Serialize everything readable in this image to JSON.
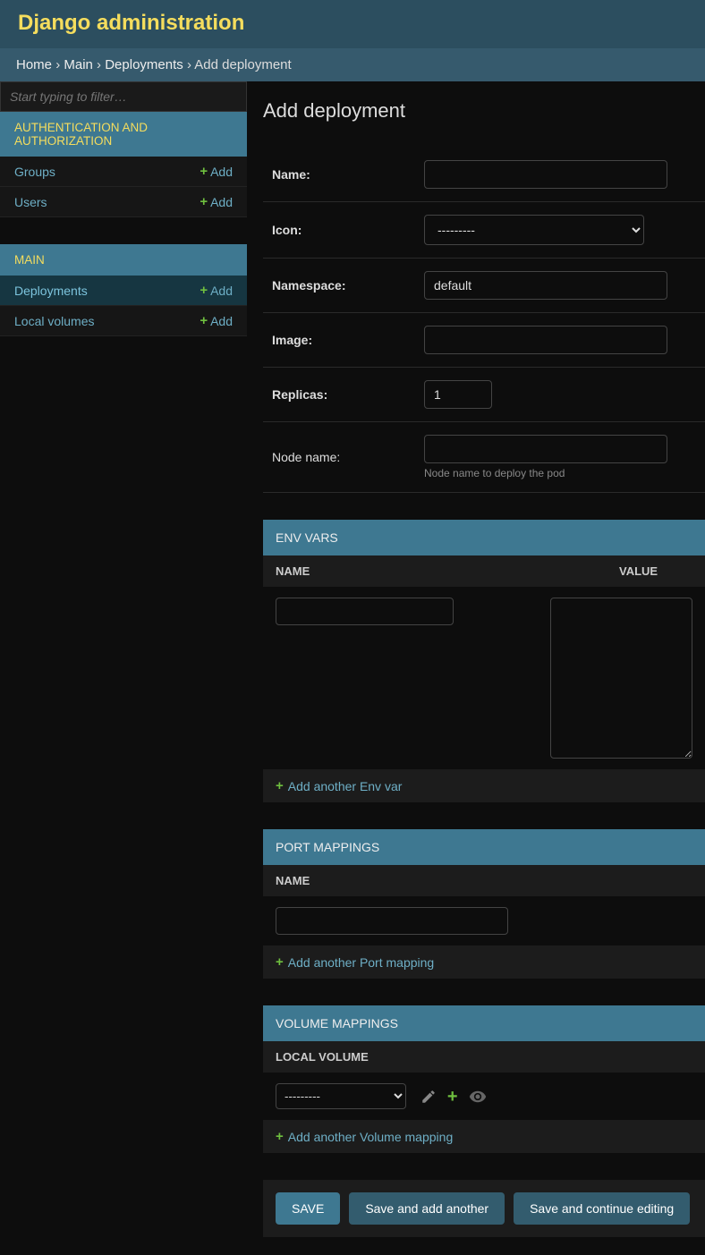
{
  "header": {
    "title": "Django administration"
  },
  "breadcrumbs": {
    "home": "Home",
    "main": "Main",
    "deployments": "Deployments",
    "current": "Add deployment",
    "sep": "›"
  },
  "sidebar": {
    "filter_placeholder": "Start typing to filter…",
    "apps": [
      {
        "label": "AUTHENTICATION AND AUTHORIZATION",
        "models": [
          {
            "name": "Groups",
            "add": "Add"
          },
          {
            "name": "Users",
            "add": "Add"
          }
        ]
      },
      {
        "label": "MAIN",
        "models": [
          {
            "name": "Deployments",
            "add": "Add",
            "active": true
          },
          {
            "name": "Local volumes",
            "add": "Add"
          }
        ]
      }
    ]
  },
  "page": {
    "title": "Add deployment"
  },
  "form": {
    "name_label": "Name:",
    "icon_label": "Icon:",
    "icon_blank": "---------",
    "namespace_label": "Namespace:",
    "namespace_value": "default",
    "image_label": "Image:",
    "replicas_label": "Replicas:",
    "replicas_value": "1",
    "node_name_label": "Node name:",
    "node_name_help": "Node name to deploy the pod"
  },
  "inlines": {
    "env": {
      "title": "ENV VARS",
      "col_name": "NAME",
      "col_value": "VALUE",
      "add": "Add another Env var"
    },
    "ports": {
      "title": "PORT MAPPINGS",
      "col_name": "NAME",
      "add": "Add another Port mapping"
    },
    "volumes": {
      "title": "VOLUME MAPPINGS",
      "col_local": "LOCAL VOLUME",
      "blank": "---------",
      "add": "Add another Volume mapping"
    }
  },
  "submit": {
    "save": "SAVE",
    "save_add": "Save and add another",
    "save_cont": "Save and continue editing"
  }
}
